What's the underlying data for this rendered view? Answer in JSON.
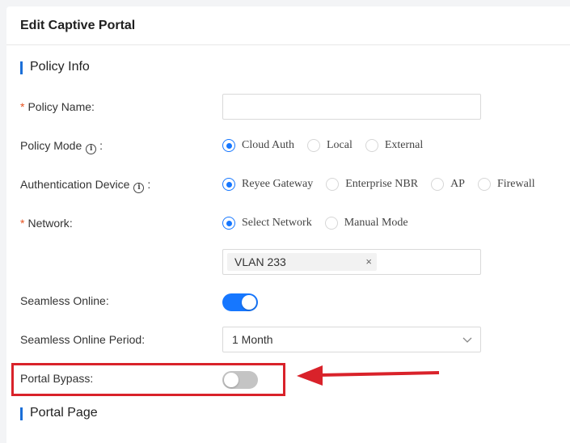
{
  "header": {
    "title": "Edit Captive Portal"
  },
  "sections": {
    "policy_info": "Policy Info",
    "portal_page": "Portal Page"
  },
  "fields": {
    "policy_name": {
      "required_mark": "*",
      "label": "Policy Name",
      "colon": ":",
      "value": ""
    },
    "policy_mode": {
      "label": "Policy Mode",
      "colon": ":",
      "options": [
        "Cloud Auth",
        "Local",
        "External"
      ],
      "selected": "Cloud Auth"
    },
    "auth_device": {
      "label": "Authentication Device",
      "colon": ":",
      "options": [
        "Reyee Gateway",
        "Enterprise NBR",
        "AP",
        "Firewall"
      ],
      "selected": "Reyee Gateway"
    },
    "network": {
      "required_mark": "*",
      "label": "Network",
      "colon": ":",
      "options": [
        "Select Network",
        "Manual Mode"
      ],
      "selected": "Select Network",
      "tag": "VLAN 233",
      "tag_remove": "×"
    },
    "seamless_online": {
      "label": "Seamless Online",
      "colon": ":",
      "enabled": true
    },
    "seamless_period": {
      "label": "Seamless Online Period",
      "colon": ":",
      "value": "1 Month"
    },
    "portal_bypass": {
      "label": "Portal Bypass",
      "colon": ":",
      "enabled": false
    }
  },
  "icons": {
    "info": "info-circle-icon",
    "dropdown": "chevron-down-icon",
    "tag_close": "close-icon"
  },
  "colors": {
    "accent": "#1677ff",
    "section_bar": "#1b6fd8",
    "required": "#e6521f",
    "annotation": "#d9222a"
  }
}
